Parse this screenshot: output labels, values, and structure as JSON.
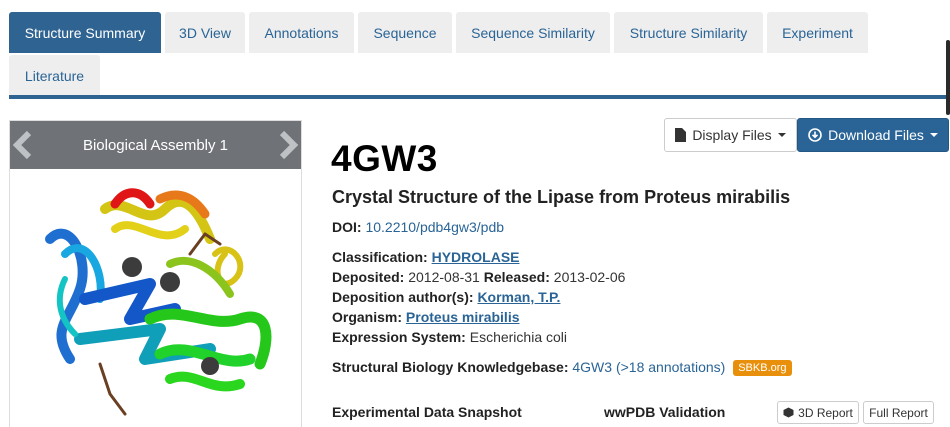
{
  "tabs": [
    {
      "label": "Structure Summary",
      "active": true
    },
    {
      "label": "3D View"
    },
    {
      "label": "Annotations"
    },
    {
      "label": "Sequence"
    },
    {
      "label": "Sequence Similarity"
    },
    {
      "label": "Structure Similarity"
    },
    {
      "label": "Experiment"
    },
    {
      "label": "Literature"
    }
  ],
  "assembly": {
    "label": "Biological Assembly 1"
  },
  "buttons": {
    "display_files": "Display Files",
    "download_files": "Download Files"
  },
  "entry": {
    "id": "4GW3",
    "title": "Crystal Structure of the Lipase from Proteus mirabilis",
    "doi_label": "DOI:",
    "doi_value": "10.2210/pdb4gw3/pdb",
    "classification_label": "Classification:",
    "classification_value": "HYDROLASE",
    "deposited_label": "Deposited:",
    "deposited_value": "2012-08-31",
    "released_label": "Released:",
    "released_value": "2013-02-06",
    "authors_label": "Deposition author(s):",
    "authors_value": "Korman, T.P.",
    "organism_label": "Organism:",
    "organism_value": "Proteus mirabilis",
    "expression_label": "Expression System:",
    "expression_value": "Escherichia coli",
    "sbkb_label": "Structural Biology Knowledgebase:",
    "sbkb_id": "4GW3",
    "sbkb_annotations": ">18 annotations",
    "sbkb_badge": "SBKB.org"
  },
  "snapshot": {
    "experimental_label": "Experimental Data Snapshot",
    "validation_label": "wwPDB Validation",
    "report_3d": "3D Report",
    "full_report": "Full Report"
  },
  "colors": {
    "tab_active": "#2f6391",
    "link": "#2a6496",
    "badge": "#e8900c"
  }
}
